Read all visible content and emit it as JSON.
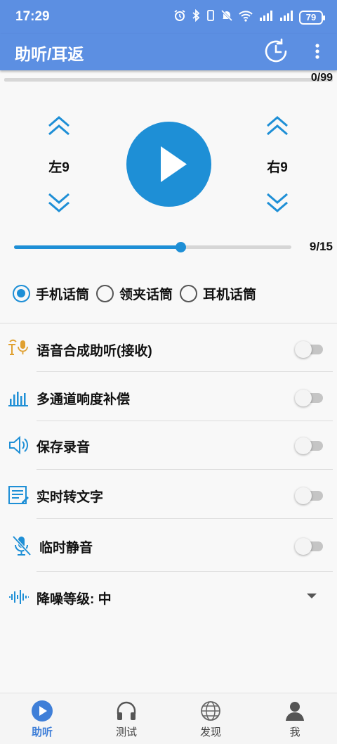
{
  "status_bar": {
    "time": "17:29",
    "battery": "79"
  },
  "app_bar": {
    "title": "助听/耳返"
  },
  "progress": {
    "count": "0/99",
    "fraction": 0.0
  },
  "volume": {
    "left_label": "左9",
    "right_label": "右9"
  },
  "gain_slider": {
    "value_label": "9/15",
    "value": 9,
    "max": 15
  },
  "mic_options": [
    {
      "label": "手机话筒",
      "selected": true
    },
    {
      "label": "领夹话筒",
      "selected": false
    },
    {
      "label": "耳机话筒",
      "selected": false
    }
  ],
  "settings": [
    {
      "label": "语音合成助听(接收)",
      "icon": "speech-synthesis-icon",
      "on": false
    },
    {
      "label": "多通道响度补偿",
      "icon": "equalizer-bars-icon",
      "on": false
    },
    {
      "label": "保存录音",
      "icon": "speaker-icon",
      "on": false
    },
    {
      "label": "实时转文字",
      "icon": "transcript-icon",
      "on": false
    },
    {
      "label": "临时静音",
      "icon": "mic-mute-icon",
      "on": false
    }
  ],
  "noise_level": {
    "label": "降噪等级:  中",
    "icon": "waveform-icon"
  },
  "bottom_nav": [
    {
      "label": "助听",
      "icon": "play-circle-icon",
      "active": true
    },
    {
      "label": "测试",
      "icon": "headphones-icon",
      "active": false
    },
    {
      "label": "发现",
      "icon": "globe-icon",
      "active": false
    },
    {
      "label": "我",
      "icon": "person-icon",
      "active": false
    }
  ],
  "colors": {
    "primary": "#5c8fe2",
    "accent": "#1e8fd6",
    "speech_icon": "#e0a030"
  }
}
